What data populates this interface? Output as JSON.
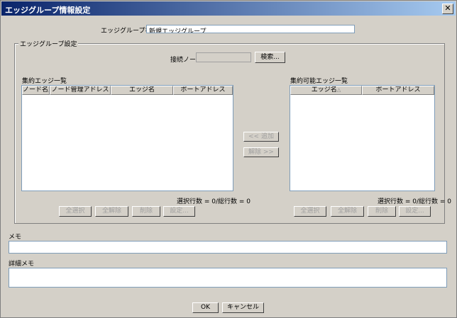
{
  "window": {
    "title": "エッジグループ情報設定"
  },
  "group_name": {
    "label": "エッジグループ名",
    "value": "新規エッジグループ"
  },
  "group_settings": {
    "legend": "エッジグループ設定",
    "connect_node_label": "接続ノード",
    "search_button": "検索..."
  },
  "aggregated": {
    "title": "集約エッジ一覧",
    "columns": [
      "ノード名",
      "ノード管理アドレス",
      "エッジ名",
      "ポートアドレス"
    ],
    "status": "選択行数 = 0/総行数 = 0",
    "buttons": {
      "select_all": "全選択",
      "deselect_all": "全解除",
      "delete": "削除",
      "settings": "設定..."
    }
  },
  "middle": {
    "add_button": "<< 追加",
    "remove_button": "解除 >>"
  },
  "available": {
    "title": "集約可能エッジ一覧",
    "columns": [
      "エッジ名",
      "ポートアドレス"
    ],
    "status": "選択行数 = 0/総行数 = 0",
    "buttons": {
      "select_all": "全選択",
      "deselect_all": "全解除",
      "delete": "削除",
      "settings": "設定..."
    }
  },
  "memo": {
    "label": "メモ",
    "value": ""
  },
  "detail_memo": {
    "label": "詳細メモ",
    "value": ""
  },
  "footer": {
    "ok": "OK",
    "cancel": "キャンセル"
  },
  "colors": {
    "titlebar_start": "#0a246a",
    "titlebar_end": "#a6caf0",
    "background": "#d4d0c8"
  }
}
